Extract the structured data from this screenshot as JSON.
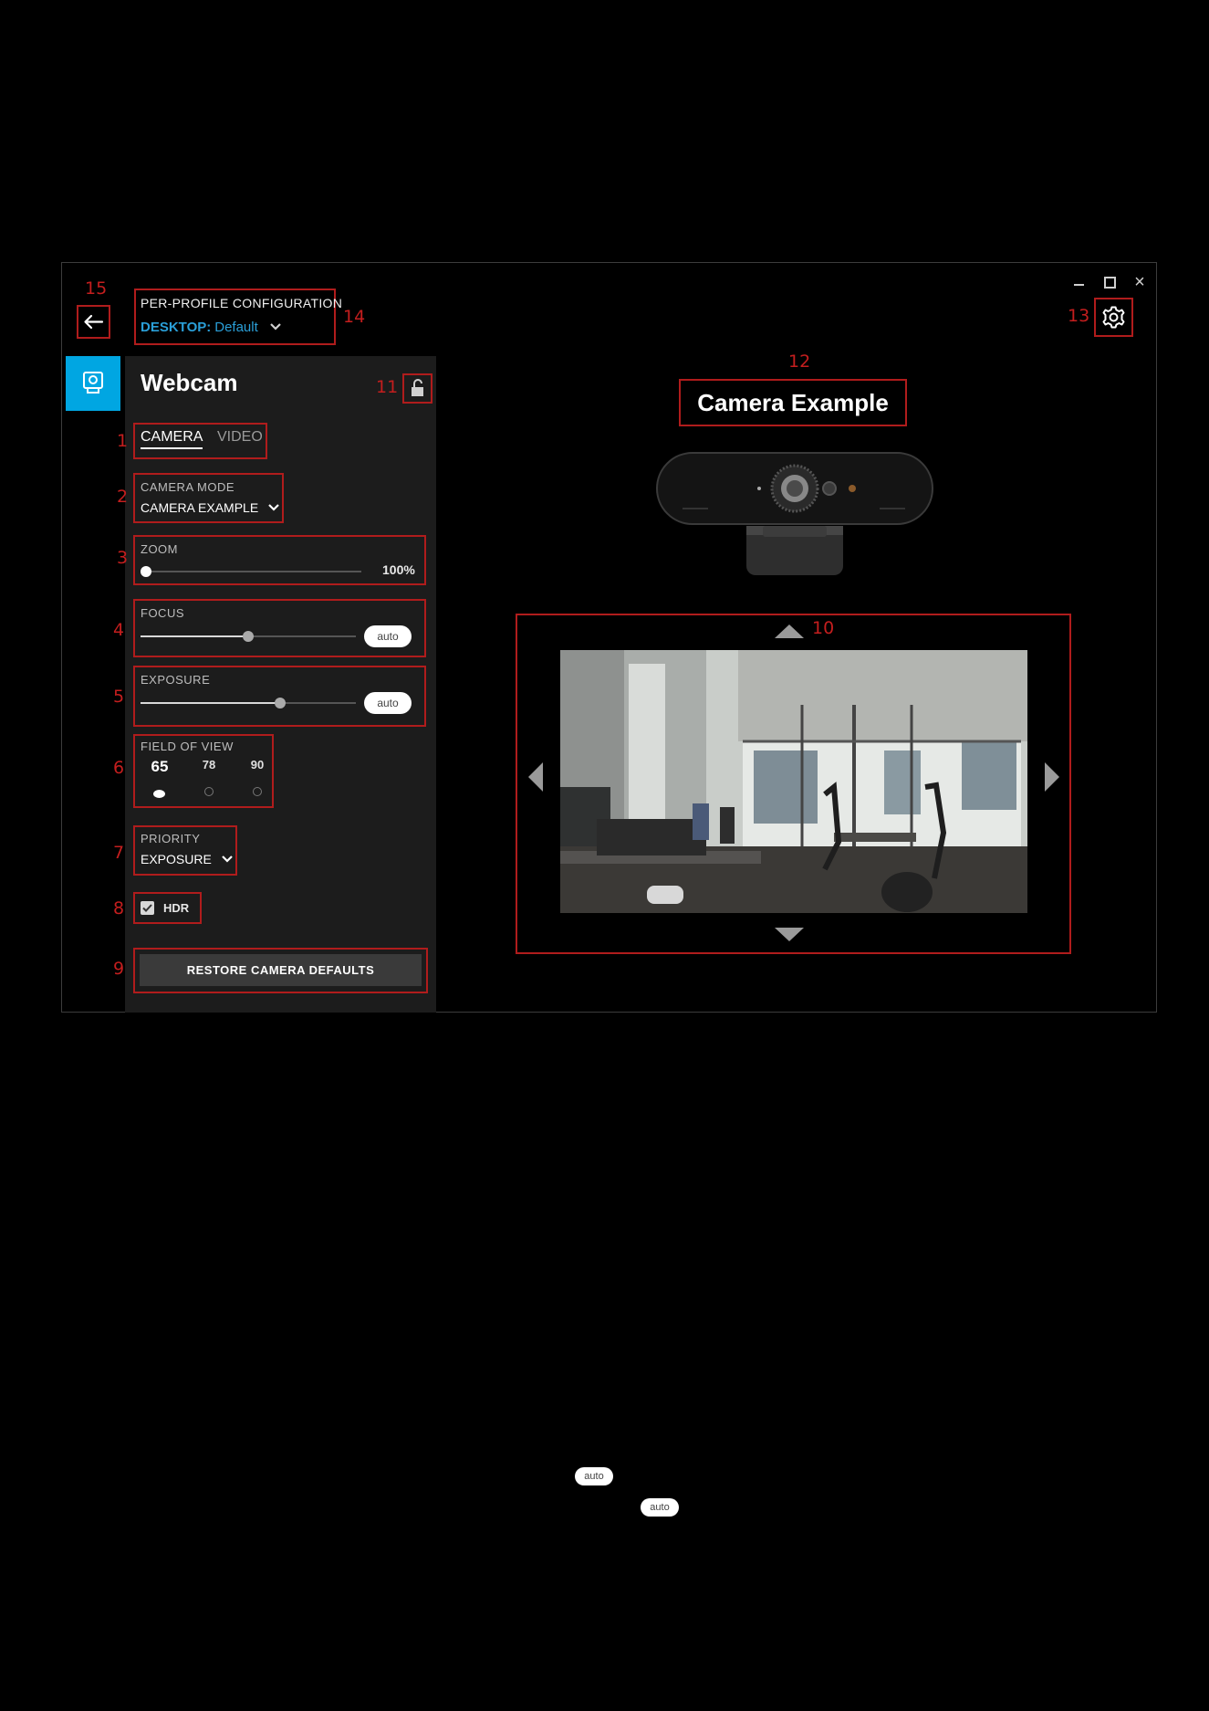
{
  "window": {
    "controls": {
      "minimize": "minimize-icon",
      "maximize": "maximize-icon",
      "close": "×"
    }
  },
  "header": {
    "title": "PER-PROFILE CONFIGURATION",
    "profile_platform": "DESKTOP:",
    "profile_name": "Default"
  },
  "sidebar": {
    "device_icon": "webcam-icon",
    "title": "Webcam",
    "tabs": [
      {
        "label": "CAMERA",
        "active": true
      },
      {
        "label": "VIDEO",
        "active": false
      }
    ],
    "camera_mode": {
      "label": "CAMERA MODE",
      "value": "CAMERA EXAMPLE"
    },
    "zoom": {
      "label": "ZOOM",
      "value_text": "100%",
      "level": 0
    },
    "focus": {
      "label": "FOCUS",
      "level": 0.5,
      "auto_label": "auto"
    },
    "exposure": {
      "label": "EXPOSURE",
      "level": 0.65,
      "auto_label": "auto"
    },
    "field_of_view": {
      "label": "FIELD OF VIEW",
      "options": [
        "65",
        "78",
        "90"
      ],
      "selected": "65"
    },
    "priority": {
      "label": "PRIORITY",
      "value": "EXPOSURE"
    },
    "hdr": {
      "label": "HDR",
      "checked": true
    },
    "restore_button": "RESTORE CAMERA DEFAULTS"
  },
  "main": {
    "camera_title": "Camera Example"
  },
  "callouts": [
    "1",
    "2",
    "3",
    "4",
    "5",
    "6",
    "7",
    "8",
    "9",
    "10",
    "11",
    "12",
    "13",
    "14",
    "15"
  ],
  "stray_pills": [
    "auto",
    "auto"
  ],
  "colors": {
    "accent_blue": "#00a6e2",
    "profile_blue": "#2a9fd8",
    "callout_red": "#b01c1c",
    "panel_bg": "#1c1c1c"
  }
}
